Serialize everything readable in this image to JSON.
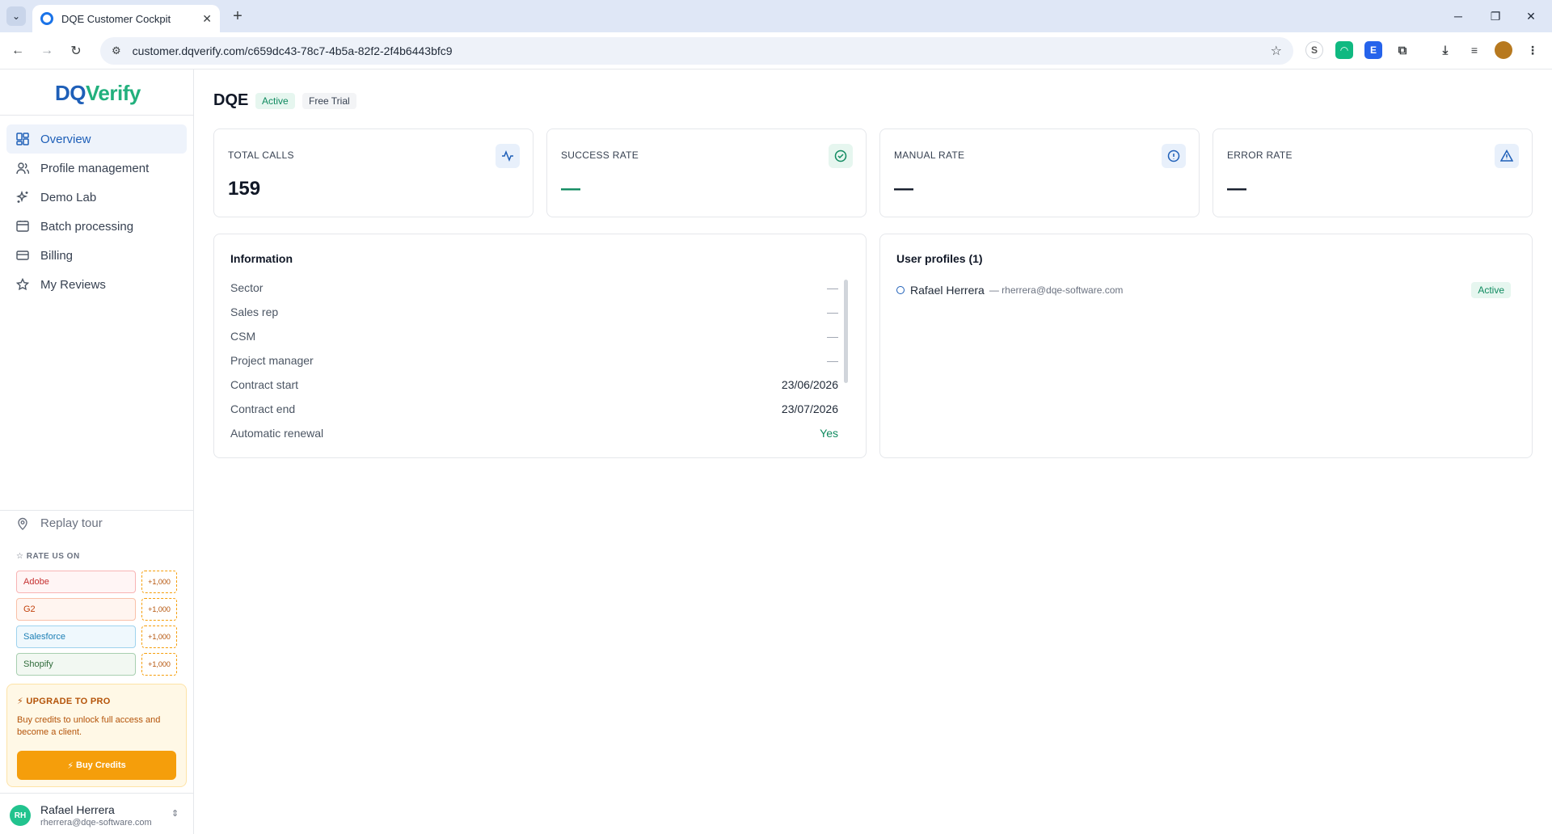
{
  "browser": {
    "tab_title": "DQE Customer Cockpit",
    "url": "customer.dqverify.com/c659dc43-78c7-4b5a-82f2-2f4b6443bfc9"
  },
  "brand": {
    "logo_dq": "DQ",
    "logo_v": "V",
    "logo_rest": "erify",
    "primary": "#1e5fb8",
    "accent": "#22b07d"
  },
  "sidebar": {
    "items": [
      {
        "label": "Overview",
        "icon": "dashboard-icon",
        "active": true
      },
      {
        "label": "Profile management",
        "icon": "users-icon"
      },
      {
        "label": "Demo Lab",
        "icon": "sparkles-icon"
      },
      {
        "label": "Batch processing",
        "icon": "calendar-icon"
      },
      {
        "label": "Billing",
        "icon": "credit-card-icon"
      },
      {
        "label": "My Reviews",
        "icon": "star-icon"
      }
    ],
    "replay_tour": "Replay tour",
    "rate_title": "☆ RATE US ON",
    "rate_items": [
      {
        "label": "Adobe",
        "bonus": "+1,000"
      },
      {
        "label": "G2",
        "bonus": "+1,000"
      },
      {
        "label": "Salesforce",
        "bonus": "+1,000"
      },
      {
        "label": "Shopify",
        "bonus": "+1,000"
      }
    ],
    "upgrade": {
      "title": "UPGRADE TO PRO",
      "text": "Buy credits to unlock full access and become a client.",
      "button": "Buy Credits"
    },
    "user": {
      "initials": "RH",
      "name": "Rafael Herrera",
      "email": "rherrera@dqe-software.com"
    }
  },
  "header": {
    "title": "DQE",
    "status": "Active",
    "plan": "Free Trial"
  },
  "stats": [
    {
      "label": "TOTAL CALLS",
      "value": "159",
      "icon": "activity-icon"
    },
    {
      "label": "SUCCESS RATE",
      "value": "—",
      "icon": "check-circle-icon"
    },
    {
      "label": "MANUAL RATE",
      "value": "—",
      "icon": "info-icon"
    },
    {
      "label": "ERROR RATE",
      "value": "—",
      "icon": "warning-icon"
    }
  ],
  "information": {
    "title": "Information",
    "rows": [
      {
        "label": "Sector",
        "value": "—"
      },
      {
        "label": "Sales rep",
        "value": "—"
      },
      {
        "label": "CSM",
        "value": "—"
      },
      {
        "label": "Project manager",
        "value": "—"
      },
      {
        "label": "Contract start",
        "value": "23/06/2026"
      },
      {
        "label": "Contract end",
        "value": "23/07/2026"
      },
      {
        "label": "Automatic renewal",
        "value": "Yes"
      }
    ]
  },
  "profiles": {
    "title": "User profiles (1)",
    "items": [
      {
        "name": "Rafael Herrera",
        "email": "— rherrera@dqe-software.com",
        "status": "Active"
      }
    ]
  }
}
